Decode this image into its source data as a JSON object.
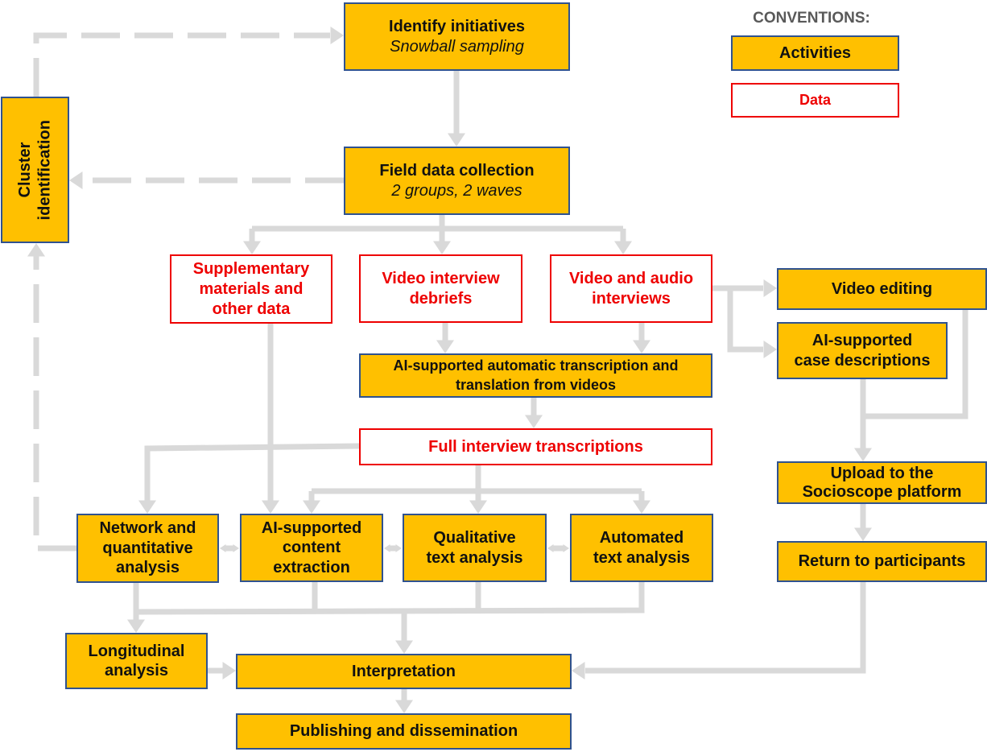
{
  "diagram": {
    "conventions": {
      "title": "CONVENTIONS:",
      "activities_label": "Activities",
      "data_label": "Data",
      "activity_fill": "#ffc000",
      "activity_border": "#2f528f",
      "data_border": "#ee0000",
      "connector_color": "#d9d9d9"
    },
    "nodes": {
      "identify": {
        "title": "Identify initiatives",
        "subtitle": "Snowball sampling",
        "type": "activity"
      },
      "field": {
        "title": "Field data collection",
        "subtitle": "2 groups, 2 waves",
        "type": "activity"
      },
      "cluster": {
        "line1": "Cluster",
        "line2": "identification",
        "type": "activity"
      },
      "supplementary": {
        "line1": "Supplementary",
        "line2": "materials and",
        "line3": "other data",
        "type": "data"
      },
      "debriefs": {
        "line1": "Video interview",
        "line2": "debriefs",
        "type": "data"
      },
      "interviews": {
        "line1": "Video and audio",
        "line2": "interviews",
        "type": "data"
      },
      "transcription": {
        "line1": "AI-supported automatic transcription and",
        "line2": "translation from videos",
        "type": "activity"
      },
      "full_transcriptions": {
        "title": "Full interview transcriptions",
        "type": "data"
      },
      "video_editing": {
        "title": "Video editing",
        "type": "activity"
      },
      "case_descriptions": {
        "line1": "AI-supported",
        "line2": "case descriptions",
        "type": "activity"
      },
      "upload": {
        "line1": "Upload to the",
        "line2": "Socioscope platform",
        "type": "activity"
      },
      "return": {
        "title": "Return to participants",
        "type": "activity"
      },
      "network": {
        "line1": "Network and",
        "line2": "quantitative",
        "line3": "analysis",
        "type": "activity"
      },
      "content_extraction": {
        "line1": "AI-supported",
        "line2": "content",
        "line3": "extraction",
        "type": "activity"
      },
      "qualitative": {
        "line1": "Qualitative",
        "line2": "text analysis",
        "type": "activity"
      },
      "automated": {
        "line1": "Automated",
        "line2": "text analysis",
        "type": "activity"
      },
      "longitudinal": {
        "line1": "Longitudinal",
        "line2": "analysis",
        "type": "activity"
      },
      "interpretation": {
        "title": "Interpretation",
        "type": "activity"
      },
      "publishing": {
        "title": "Publishing and dissemination",
        "type": "activity"
      }
    },
    "edges": [
      {
        "from": "identify",
        "to": "field",
        "style": "solid"
      },
      {
        "from": "field",
        "to": "cluster",
        "style": "dashed"
      },
      {
        "from": "cluster",
        "to": "identify",
        "style": "dashed"
      },
      {
        "from": "field",
        "to": "supplementary",
        "style": "solid"
      },
      {
        "from": "field",
        "to": "debriefs",
        "style": "solid"
      },
      {
        "from": "field",
        "to": "interviews",
        "style": "solid"
      },
      {
        "from": "debriefs",
        "to": "transcription",
        "style": "solid"
      },
      {
        "from": "interviews",
        "to": "transcription",
        "style": "solid"
      },
      {
        "from": "interviews",
        "to": "video_editing",
        "style": "solid"
      },
      {
        "from": "interviews",
        "to": "case_descriptions",
        "style": "solid"
      },
      {
        "from": "transcription",
        "to": "full_transcriptions",
        "style": "solid"
      },
      {
        "from": "full_transcriptions",
        "to": "network",
        "style": "solid"
      },
      {
        "from": "supplementary",
        "to": "content_extraction",
        "style": "solid"
      },
      {
        "from": "full_transcriptions",
        "to": "content_extraction",
        "style": "solid"
      },
      {
        "from": "full_transcriptions",
        "to": "qualitative",
        "style": "solid"
      },
      {
        "from": "full_transcriptions",
        "to": "automated",
        "style": "solid"
      },
      {
        "from": "network",
        "to": "content_extraction",
        "style": "bidirectional"
      },
      {
        "from": "content_extraction",
        "to": "qualitative",
        "style": "bidirectional"
      },
      {
        "from": "qualitative",
        "to": "automated",
        "style": "bidirectional"
      },
      {
        "from": "network",
        "to": "cluster",
        "style": "dashed"
      },
      {
        "from": "video_editing",
        "to": "upload",
        "style": "solid"
      },
      {
        "from": "case_descriptions",
        "to": "upload",
        "style": "solid"
      },
      {
        "from": "upload",
        "to": "return",
        "style": "solid"
      },
      {
        "from": "return",
        "to": "interpretation",
        "style": "solid"
      },
      {
        "from": "analyses",
        "to": "longitudinal",
        "style": "solid"
      },
      {
        "from": "analyses",
        "to": "interpretation",
        "style": "solid"
      },
      {
        "from": "longitudinal",
        "to": "interpretation",
        "style": "solid"
      },
      {
        "from": "interpretation",
        "to": "publishing",
        "style": "solid"
      }
    ]
  }
}
